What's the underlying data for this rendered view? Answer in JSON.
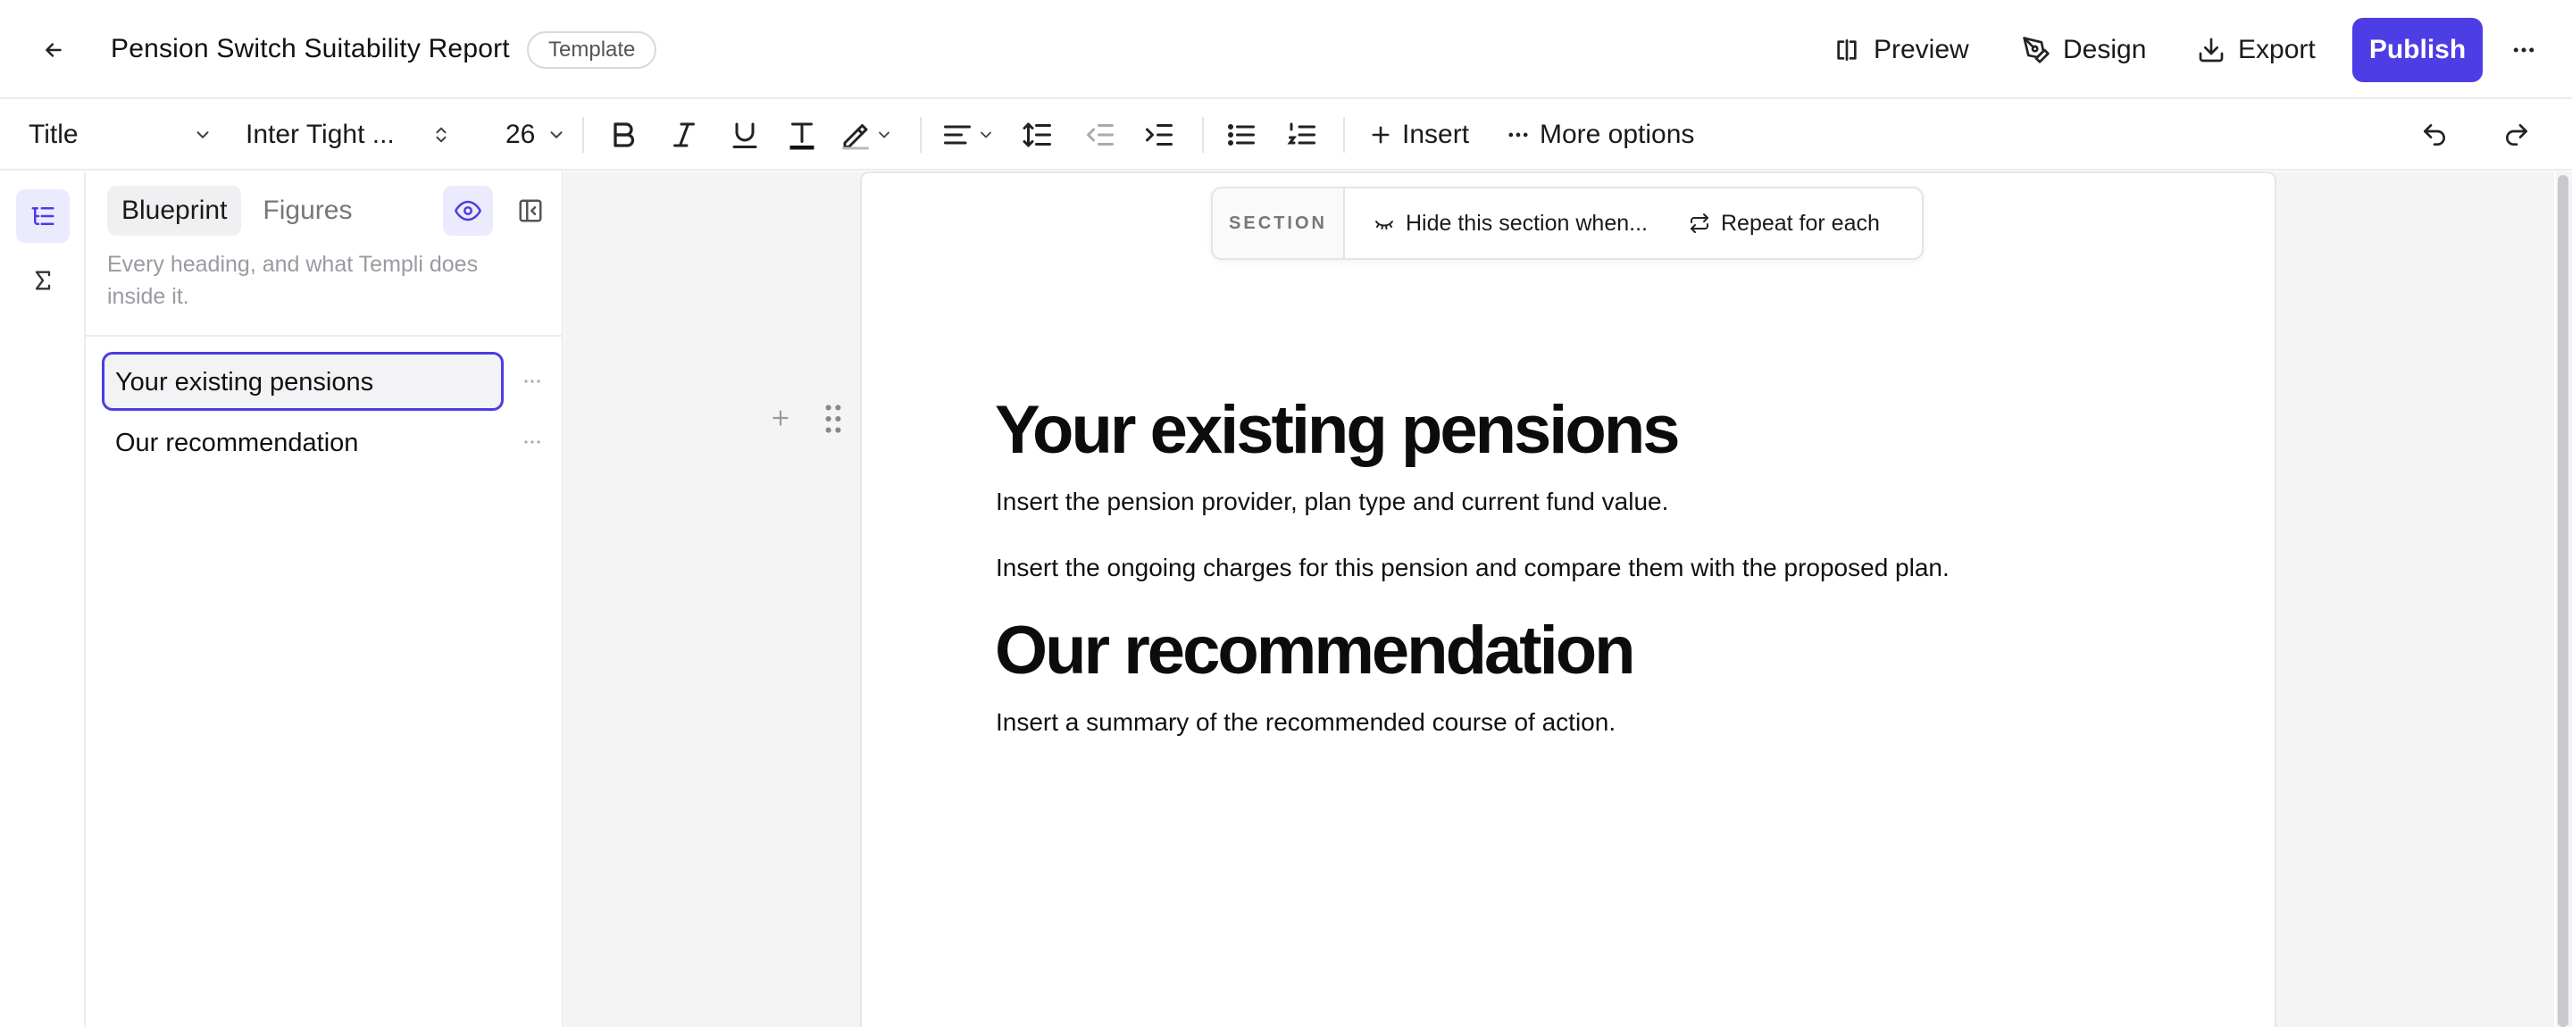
{
  "header": {
    "title": "Pension Switch Suitability Report",
    "badge": "Template",
    "preview_label": "Preview",
    "design_label": "Design",
    "export_label": "Export",
    "publish_label": "Publish",
    "accent_color": "#4c3de4"
  },
  "toolbar": {
    "style_select": "Title",
    "font_select": "Inter Tight ...",
    "size_select": "26",
    "insert_label": "Insert",
    "more_options_label": "More options"
  },
  "sidebar": {
    "tabs": [
      {
        "label": "Blueprint",
        "active": true
      },
      {
        "label": "Figures",
        "active": false
      }
    ],
    "description": "Every heading, and what Templi does inside it.",
    "items": [
      {
        "label": "Your existing pensions",
        "selected": true
      },
      {
        "label": "Our recommendation",
        "selected": false
      }
    ]
  },
  "section_toolbar": {
    "label": "SECTION",
    "hide_label": "Hide this section when...",
    "repeat_label": "Repeat for each"
  },
  "document": {
    "sections": [
      {
        "heading": "Your existing pensions",
        "paragraphs": [
          "Insert the pension provider, plan type and current fund value.",
          "Insert the ongoing charges for this pension and compare them with the proposed plan."
        ]
      },
      {
        "heading": "Our recommendation",
        "paragraphs": [
          "Insert a summary of the recommended course of action."
        ]
      }
    ]
  }
}
